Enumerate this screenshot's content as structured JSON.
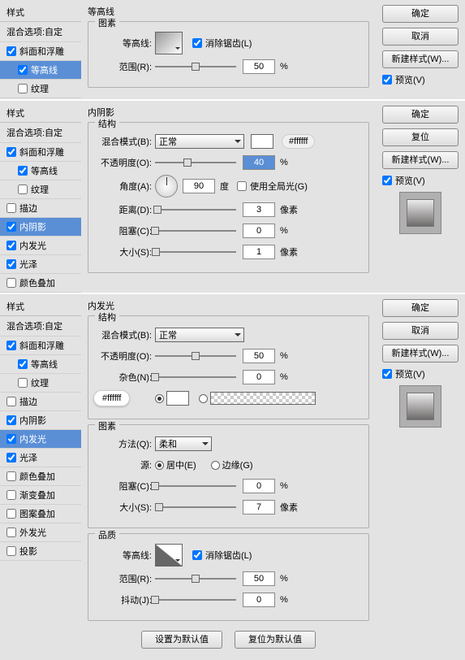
{
  "labels": {
    "style": "样式",
    "blend_opt": "混合选项:自定",
    "ok": "确定",
    "cancel": "取消",
    "reset": "复位",
    "new_style": "新建样式(W)...",
    "preview": "预览(V)"
  },
  "styles": {
    "bevel": "斜面和浮雕",
    "contour": "等高线",
    "texture": "纹理",
    "stroke": "描边",
    "inner_shadow": "内阴影",
    "inner_glow": "内发光",
    "satin": "光泽",
    "color_overlay": "颜色叠加",
    "grad_overlay": "渐变叠加",
    "pattern_overlay": "图案叠加",
    "outer_glow": "外发光",
    "drop_shadow": "投影"
  },
  "p1": {
    "title": "等高线",
    "group": "图素",
    "contour_label": "等高线:",
    "anti_alias": "消除锯齿(L)",
    "range_label": "范围(R):",
    "range_value": "50",
    "pct": "%"
  },
  "p2": {
    "title": "内阴影",
    "group": "结构",
    "blend_label": "混合模式(B):",
    "blend_value": "正常",
    "color_hex": "#ffffff",
    "opacity_label": "不透明度(O):",
    "opacity_value": "40",
    "pct": "%",
    "angle_label": "角度(A):",
    "angle_value": "90",
    "deg": "度",
    "global": "使用全局光(G)",
    "distance_label": "距离(D):",
    "distance_value": "3",
    "px": "像素",
    "choke_label": "阻塞(C):",
    "choke_value": "0",
    "size_label": "大小(S):",
    "size_value": "1"
  },
  "p3": {
    "title": "内发光",
    "group_struct": "结构",
    "blend_label": "混合模式(B):",
    "blend_value": "正常",
    "opacity_label": "不透明度(O):",
    "opacity_value": "50",
    "noise_label": "杂色(N):",
    "noise_value": "0",
    "color_hex": "#ffffff",
    "group_elem": "图素",
    "technique_label": "方法(Q):",
    "technique_value": "柔和",
    "source_label": "源:",
    "source_center": "居中(E)",
    "source_edge": "边缘(G)",
    "choke_label": "阻塞(C):",
    "choke_value": "0",
    "size_label": "大小(S):",
    "size_value": "7",
    "px": "像素",
    "pct": "%",
    "group_quality": "品质",
    "contour_label": "等高线:",
    "anti_alias": "消除锯齿(L)",
    "range_label": "范围(R):",
    "range_value": "50",
    "jitter_label": "抖动(J):",
    "jitter_value": "0",
    "set_default": "设置为默认值",
    "reset_default": "复位为默认值"
  }
}
